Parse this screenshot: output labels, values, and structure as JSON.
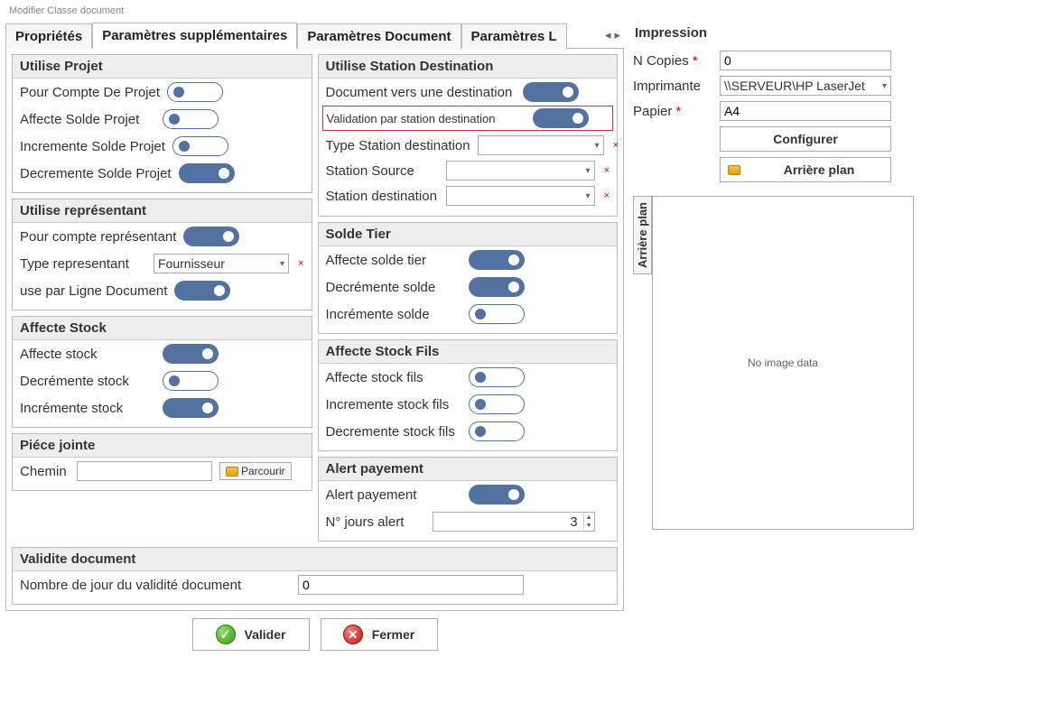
{
  "window": {
    "title": "Modifier Classe document"
  },
  "tabs": {
    "list": [
      "Propriétés",
      "Paramètres supplémentaires",
      "Paramètres Document",
      "Paramètres L"
    ],
    "active_index": 1
  },
  "groups": {
    "utilise_projet": {
      "title": "Utilise Projet",
      "pour_compte": "Pour Compte De Projet",
      "affecte_solde": "Affecte Solde Projet",
      "incr_solde": "Incremente Solde Projet",
      "decr_solde": "Decremente Solde Projet"
    },
    "utilise_representant": {
      "title": "Utilise représentant",
      "pour_compte": "Pour compte représentant",
      "type_label": "Type representant",
      "type_value": "Fournisseur",
      "use_ligne": "use par Ligne Document"
    },
    "affecte_stock": {
      "title": "Affecte Stock",
      "affecte": "Affecte stock",
      "decr": "Decrémente stock",
      "incr": "Incrémente stock"
    },
    "piece_jointe": {
      "title": "Piéce jointe",
      "chemin_label": "Chemin",
      "chemin_value": "",
      "browse": "Parcourir"
    },
    "utilise_station": {
      "title": "Utilise Station Destination",
      "doc_vers": "Document vers une destination",
      "validation": "Validation par station destination",
      "type_station_label": "Type Station destination",
      "station_source_label": "Station Source",
      "station_dest_label": "Station destination"
    },
    "solde_tier": {
      "title": "Solde Tier",
      "affecte": "Affecte solde tier",
      "decr": "Decrémente solde",
      "incr": "Incrémente solde"
    },
    "affecte_stock_fils": {
      "title": "Affecte Stock Fils",
      "affecte": "Affecte stock fils",
      "incr": "Incremente stock fils",
      "decr": "Decremente stock fils"
    },
    "alert_payement": {
      "title": "Alert payement",
      "alert": "Alert payement",
      "jours_label": "N° jours alert",
      "jours_value": "3"
    },
    "validite": {
      "title": "Validite document",
      "label": "Nombre de jour du validité document",
      "value": "0"
    }
  },
  "impression": {
    "title": "Impression",
    "copies_label": "N Copies",
    "copies_value": "0",
    "imprimante_label": "Imprimante",
    "imprimante_value": "\\\\SERVEUR\\HP LaserJet",
    "papier_label": "Papier",
    "papier_value": "A4",
    "configurer": "Configurer",
    "arriere_plan": "Arrière plan",
    "preview_tab": "Arrière plan",
    "preview_msg": "No image data"
  },
  "buttons": {
    "valider": "Valider",
    "fermer": "Fermer"
  }
}
